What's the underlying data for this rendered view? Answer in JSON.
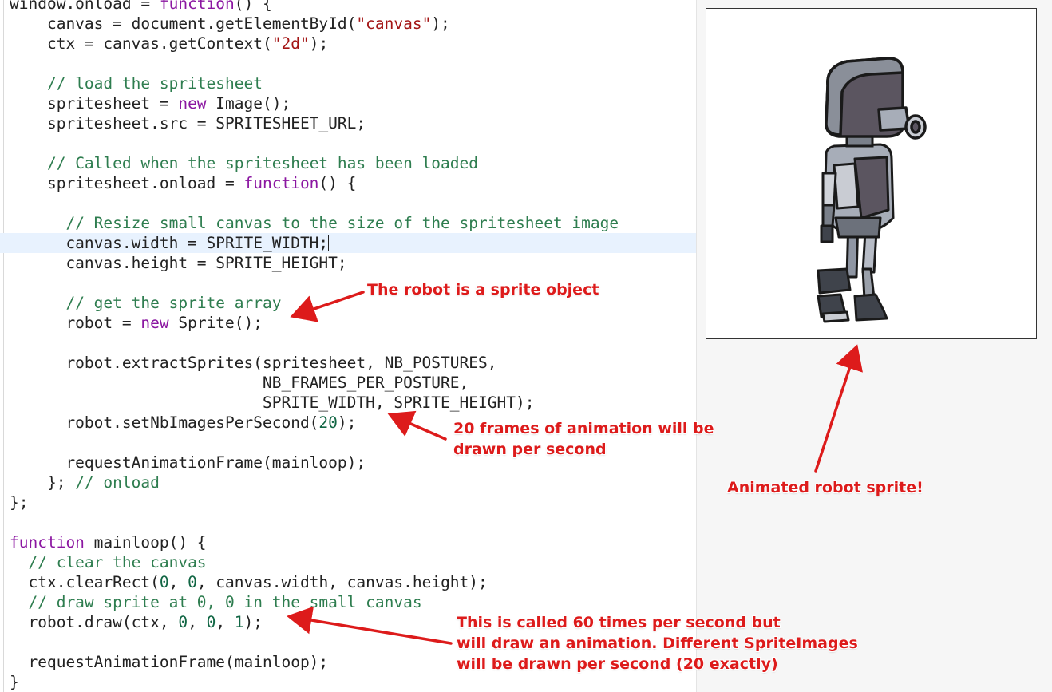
{
  "code": {
    "lines": [
      {
        "tokens": [
          {
            "t": "window.onload = "
          },
          {
            "t": "function",
            "c": "kw"
          },
          {
            "t": "() {"
          }
        ]
      },
      {
        "tokens": [
          {
            "t": "    canvas = document.getElementById("
          },
          {
            "t": "\"canvas\"",
            "c": "str"
          },
          {
            "t": ");"
          }
        ]
      },
      {
        "tokens": [
          {
            "t": "    ctx = canvas.getContext("
          },
          {
            "t": "\"2d\"",
            "c": "str"
          },
          {
            "t": ");"
          }
        ]
      },
      {
        "tokens": [
          {
            "t": ""
          }
        ]
      },
      {
        "tokens": [
          {
            "t": "    "
          },
          {
            "t": "// load the spritesheet",
            "c": "cm"
          }
        ]
      },
      {
        "tokens": [
          {
            "t": "    spritesheet = "
          },
          {
            "t": "new",
            "c": "kw"
          },
          {
            "t": " Image();"
          }
        ]
      },
      {
        "tokens": [
          {
            "t": "    spritesheet.src = SPRITESHEET_URL;"
          }
        ]
      },
      {
        "tokens": [
          {
            "t": ""
          }
        ]
      },
      {
        "tokens": [
          {
            "t": "    "
          },
          {
            "t": "// Called when the spritesheet has been loaded",
            "c": "cm"
          }
        ]
      },
      {
        "tokens": [
          {
            "t": "    spritesheet.onload = "
          },
          {
            "t": "function",
            "c": "kw"
          },
          {
            "t": "() {"
          }
        ]
      },
      {
        "tokens": [
          {
            "t": ""
          }
        ]
      },
      {
        "tokens": [
          {
            "t": "      "
          },
          {
            "t": "// Resize small canvas to the size of the spritesheet image",
            "c": "cm"
          }
        ]
      },
      {
        "tokens": [
          {
            "t": "      canvas.width = SPRITE_WIDTH;"
          }
        ],
        "highlight": true,
        "cursor": true
      },
      {
        "tokens": [
          {
            "t": "      canvas.height = SPRITE_HEIGHT;"
          }
        ]
      },
      {
        "tokens": [
          {
            "t": ""
          }
        ]
      },
      {
        "tokens": [
          {
            "t": "      "
          },
          {
            "t": "// get the sprite array",
            "c": "cm"
          }
        ]
      },
      {
        "tokens": [
          {
            "t": "      robot = "
          },
          {
            "t": "new",
            "c": "kw"
          },
          {
            "t": " Sprite();"
          }
        ]
      },
      {
        "tokens": [
          {
            "t": ""
          }
        ]
      },
      {
        "tokens": [
          {
            "t": "      robot.extractSprites(spritesheet, NB_POSTURES,"
          }
        ]
      },
      {
        "tokens": [
          {
            "t": "                           NB_FRAMES_PER_POSTURE,"
          }
        ]
      },
      {
        "tokens": [
          {
            "t": "                           SPRITE_WIDTH, SPRITE_HEIGHT);"
          }
        ]
      },
      {
        "tokens": [
          {
            "t": "      robot.setNbImagesPerSecond("
          },
          {
            "t": "20",
            "c": "num"
          },
          {
            "t": ");"
          }
        ]
      },
      {
        "tokens": [
          {
            "t": ""
          }
        ]
      },
      {
        "tokens": [
          {
            "t": "      requestAnimationFrame(mainloop);"
          }
        ]
      },
      {
        "tokens": [
          {
            "t": "    }; "
          },
          {
            "t": "// onload",
            "c": "cm"
          }
        ]
      },
      {
        "tokens": [
          {
            "t": "};"
          }
        ]
      },
      {
        "tokens": [
          {
            "t": ""
          }
        ]
      },
      {
        "tokens": [
          {
            "t": "function",
            "c": "kw"
          },
          {
            "t": " mainloop() {"
          }
        ]
      },
      {
        "tokens": [
          {
            "t": "  "
          },
          {
            "t": "// clear the canvas",
            "c": "cm"
          }
        ]
      },
      {
        "tokens": [
          {
            "t": "  ctx.clearRect("
          },
          {
            "t": "0",
            "c": "num"
          },
          {
            "t": ", "
          },
          {
            "t": "0",
            "c": "num"
          },
          {
            "t": ", canvas.width, canvas.height);"
          }
        ]
      },
      {
        "tokens": [
          {
            "t": "  "
          },
          {
            "t": "// draw sprite at 0, 0 in the small canvas",
            "c": "cm"
          }
        ]
      },
      {
        "tokens": [
          {
            "t": "  robot.draw(ctx, "
          },
          {
            "t": "0",
            "c": "num"
          },
          {
            "t": ", "
          },
          {
            "t": "0",
            "c": "num"
          },
          {
            "t": ", "
          },
          {
            "t": "1",
            "c": "num"
          },
          {
            "t": ");"
          }
        ]
      },
      {
        "tokens": [
          {
            "t": ""
          }
        ]
      },
      {
        "tokens": [
          {
            "t": "  requestAnimationFrame(mainloop);"
          }
        ]
      },
      {
        "tokens": [
          {
            "t": "}"
          }
        ]
      }
    ]
  },
  "annotations": {
    "robot_sprite": "The robot is a sprite object",
    "frames": "20 frames of animation will be\ndrawn per second",
    "animated": "Animated robot sprite!",
    "called": "This is called 60 times per second but\nwill draw an animation. Different SpriteImages\nwill be drawn per second (20 exactly)"
  },
  "colors": {
    "annotation": "#dd1b1b",
    "keyword": "#8b16a1",
    "comment": "#2e7d4f",
    "string": "#a31515",
    "highlight_line": "#e8f2fe"
  },
  "preview": {
    "image": "robot-sprite"
  }
}
